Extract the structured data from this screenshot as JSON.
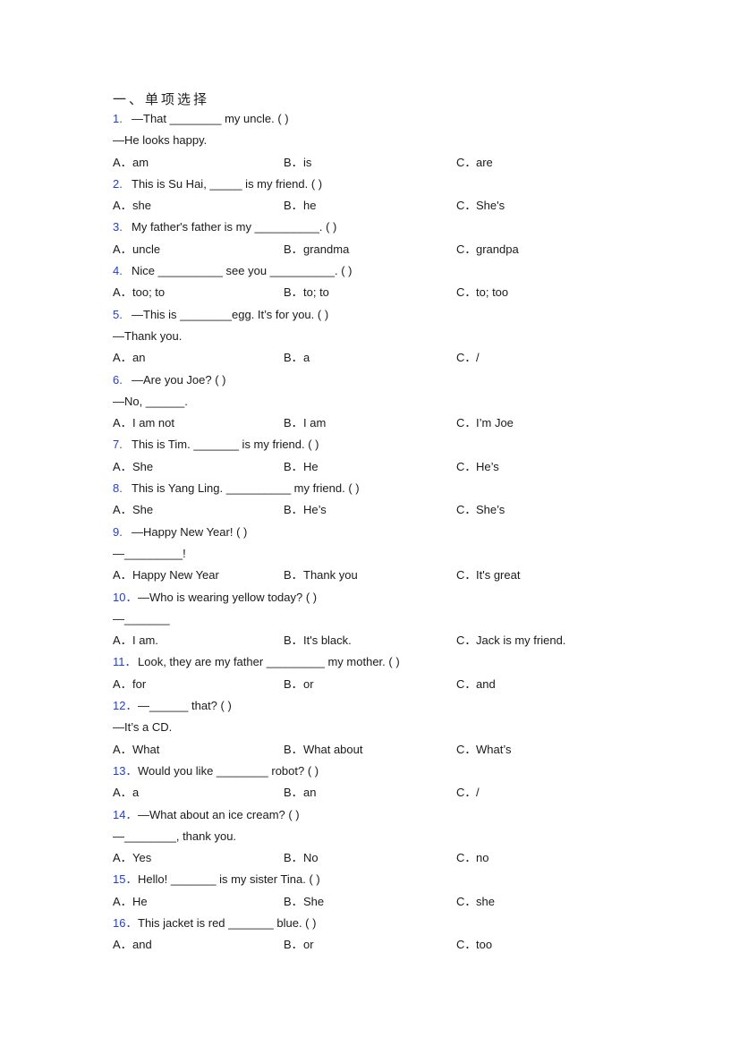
{
  "section_title": "一、单项选择",
  "colors": {
    "question_number": "#1f3fd6",
    "text": "#1a1a1a"
  },
  "questions": [
    {
      "num": "1.",
      "stem": "—That ________ my uncle. (    )",
      "extra": [
        "—He looks happy."
      ],
      "options": {
        "A": "am",
        "B": "is",
        "C": "are"
      }
    },
    {
      "num": "2.",
      "stem": "This is Su Hai, _____ is my friend. (    )",
      "extra": [],
      "options": {
        "A": "she",
        "B": "he",
        "C": "She's"
      }
    },
    {
      "num": "3.",
      "stem": "My father's father is my __________. (    )",
      "extra": [],
      "options": {
        "A": "uncle",
        "B": "grandma",
        "C": "grandpa"
      }
    },
    {
      "num": "4.",
      "stem": "Nice __________ see you __________. (    )",
      "extra": [],
      "options": {
        "A": "too; to",
        "B": "to; to",
        "C": "to; too"
      }
    },
    {
      "num": "5.",
      "stem": "—This is ________egg. It’s for you. (  )",
      "extra": [
        "—Thank you."
      ],
      "options": {
        "A": "an",
        "B": "a",
        "C": "/"
      }
    },
    {
      "num": "6.",
      "stem": "—Are you Joe? (  )",
      "extra": [
        "—No, ______."
      ],
      "options": {
        "A": "I am not",
        "B": "I am",
        "C": "I’m Joe"
      }
    },
    {
      "num": "7.",
      "stem": "This is Tim. _______ is my friend. (  )",
      "extra": [],
      "options": {
        "A": "She",
        "B": "He",
        "C": "He’s"
      }
    },
    {
      "num": "8.",
      "stem": "This is Yang Ling. __________ my friend. (  )",
      "extra": [],
      "options": {
        "A": "She",
        "B": "He’s",
        "C": "She’s"
      }
    },
    {
      "num": "9.",
      "stem": "—Happy New Year! (  )",
      "extra": [
        "—_________!"
      ],
      "options": {
        "A": "Happy New Year",
        "B": "Thank you",
        "C": "It's great"
      }
    },
    {
      "num": "10．",
      "stem": "—Who is wearing yellow today? (   )",
      "extra": [
        "—_______"
      ],
      "options": {
        "A": "I am.",
        "B": "It's black.",
        "C": "Jack is my friend."
      }
    },
    {
      "num": "11．",
      "stem": "Look, they are my father _________ my mother. (  )",
      "extra": [],
      "options": {
        "A": "for",
        "B": "or",
        "C": "and"
      }
    },
    {
      "num": "12．",
      "stem": "—______ that? (   )",
      "extra": [
        "—It’s a CD."
      ],
      "options": {
        "A": "What",
        "B": "What about",
        "C": "What’s"
      }
    },
    {
      "num": "13．",
      "stem": "Would you like ________ robot? (   )",
      "extra": [],
      "options": {
        "A": "a",
        "B": "an",
        "C": "/"
      }
    },
    {
      "num": "14．",
      "stem": "—What about an ice cream? (   )",
      "extra": [
        "—________, thank you."
      ],
      "options": {
        "A": "Yes",
        "B": "No",
        "C": "no"
      }
    },
    {
      "num": "15．",
      "stem": "Hello! _______ is my sister Tina. (  )",
      "extra": [],
      "options": {
        "A": "He",
        "B": "She",
        "C": "she"
      }
    },
    {
      "num": "16．",
      "stem": "This jacket is red _______ blue. (  )",
      "extra": [],
      "options": {
        "A": "and",
        "B": "or",
        "C": "too"
      }
    }
  ],
  "option_labels": {
    "A": "A．",
    "B": "B．",
    "C": "C．"
  }
}
